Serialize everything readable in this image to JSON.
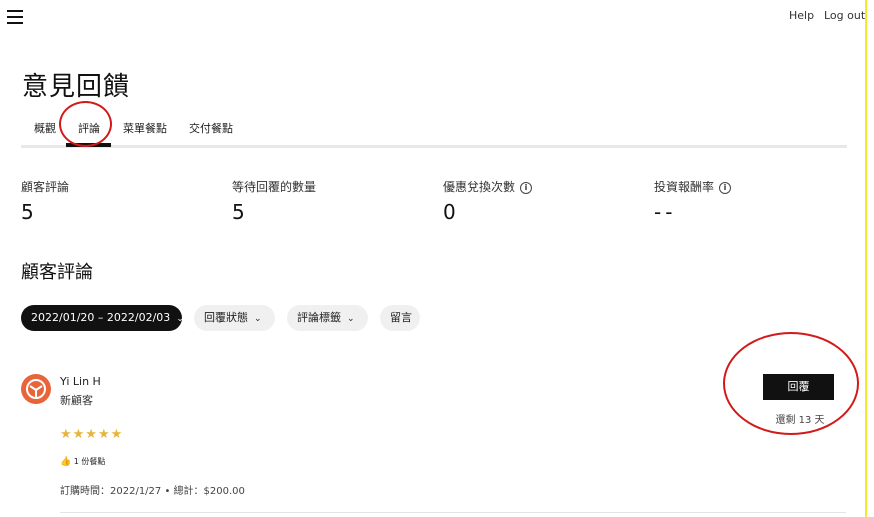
{
  "header": {
    "help_label": "Help",
    "logout_label": "Log out"
  },
  "page": {
    "title": "意見回饋"
  },
  "tabs": [
    {
      "label": "概觀",
      "active": false
    },
    {
      "label": "評論",
      "active": true
    },
    {
      "label": "菜單餐點",
      "active": false
    },
    {
      "label": "交付餐點",
      "active": false
    }
  ],
  "stats": [
    {
      "label": "顧客評論",
      "value": "5"
    },
    {
      "label": "等待回覆的數量",
      "value": "5"
    },
    {
      "label": "優惠兌換次數",
      "value": "0",
      "info_icon": "info-icon"
    },
    {
      "label": "投資報酬率",
      "value": "--",
      "info_icon": "info-icon"
    }
  ],
  "reviews_section": {
    "title": "顧客評論"
  },
  "filters": {
    "date_range": "2022/01/20 – 2022/02/03",
    "reply_status": "回覆狀態",
    "review_tags": "評論標籤",
    "comments": "留言"
  },
  "review": {
    "name": "Yi Lin H",
    "customer_tag": "新顧客",
    "rating": 5,
    "stars": "★★★★★",
    "likes": "1 份餐點",
    "order_info": "訂購時間：2022/1/27 • 總計：$200.00",
    "reply_label": "回覆",
    "remaining": "還剩 13 天"
  },
  "colors": {
    "accent_dark": "#111111",
    "annotation_red": "#d11a1a",
    "star": "#e6b53b",
    "avatar": "#e8653a"
  }
}
